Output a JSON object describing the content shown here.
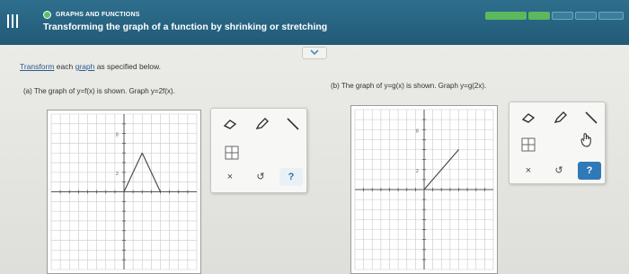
{
  "header": {
    "section": "GRAPHS AND FUNCTIONS",
    "topic": "Transforming the graph of a function by shrinking or stretching",
    "progress_segments": 5,
    "progress_complete": 1,
    "colors": {
      "bar": "#215a77",
      "progress": "#5cb85c"
    }
  },
  "main": {
    "collapse_icon": "chevron-down-icon",
    "instruction": {
      "link1": "Transform",
      "text1": " each ",
      "link2": "graph",
      "text2": " as specified below."
    },
    "parts": [
      {
        "label": "(a) The graph of y=f(x) is shown. Graph y=2f(x).",
        "graph": {
          "x_range": [
            -8,
            8
          ],
          "y_range": [
            -8,
            8
          ],
          "tick_label_y": "8",
          "tick_label_y2": "2",
          "segments": [
            [
              [
                0,
                0
              ],
              [
                2,
                4
              ]
            ],
            [
              [
                2,
                4
              ],
              [
                4,
                0
              ]
            ]
          ]
        },
        "tools": [
          "eraser-icon",
          "pencil-icon",
          "line-icon",
          "grid-icon"
        ],
        "actions": {
          "clear": "×",
          "undo": "↺",
          "help": "?"
        }
      },
      {
        "label": "(b) The graph of y=g(x) is shown. Graph y=g(2x).",
        "graph": {
          "x_range": [
            -8,
            8
          ],
          "y_range": [
            -8,
            8
          ],
          "tick_label_y": "8",
          "tick_label_y2": "2",
          "segments": [
            [
              [
                0,
                0
              ],
              [
                4,
                4
              ]
            ]
          ]
        },
        "tools": [
          "eraser-icon",
          "pencil-icon",
          "line-icon",
          "grid-icon"
        ],
        "actions": {
          "clear": "×",
          "undo": "↺",
          "help": "?"
        }
      }
    ]
  }
}
